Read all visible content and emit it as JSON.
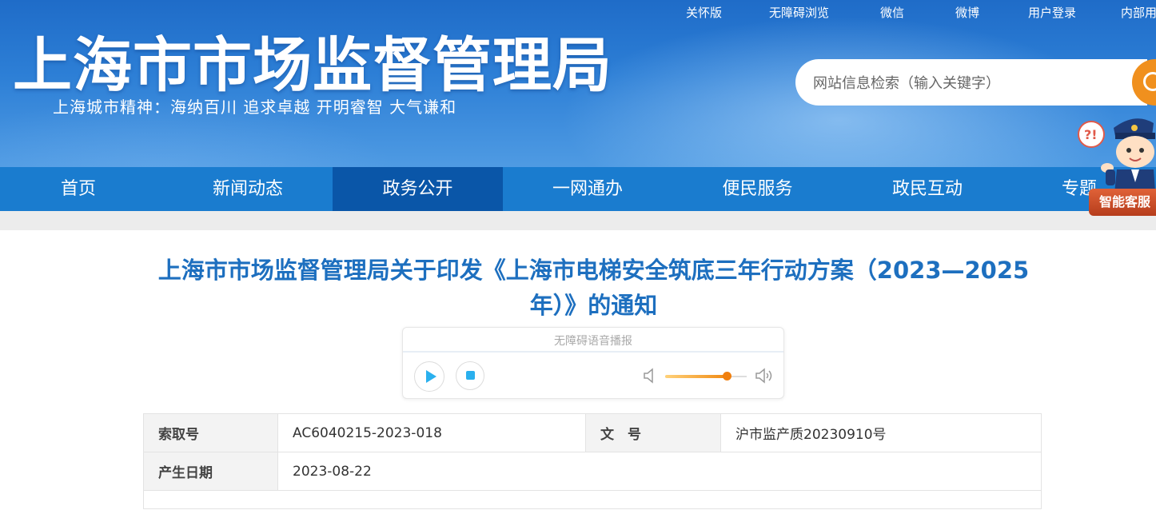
{
  "header": {
    "site_title": "上海市市场监督管理局",
    "slogan": "上海城市精神：海纳百川   追求卓越   开明睿智   大气谦和",
    "top_links": [
      "关怀版",
      "无障碍浏览",
      "微信",
      "微博",
      "用户登录",
      "内部用"
    ],
    "search_placeholder": "网站信息检索（输入关键字）",
    "service_badge": "智能客服"
  },
  "nav": {
    "items": [
      "首页",
      "新闻动态",
      "政务公开",
      "一网通办",
      "便民服务",
      "政民互动",
      "专题"
    ],
    "active_index": 2
  },
  "article": {
    "title": "上海市市场监督管理局关于印发《上海市电梯安全筑底三年行动方案（2023—2025年）》的通知"
  },
  "player": {
    "label": "无障碍语音播报",
    "volume": 0.75
  },
  "meta": {
    "index_label": "索取号",
    "index_value": "AC6040215-2023-018",
    "doc_no_label": "文　号",
    "doc_no_value": "沪市监产质20230910号",
    "date_label": "产生日期",
    "date_value": "2023-08-22"
  },
  "colors": {
    "header_blue": "#2d7fd6",
    "nav_blue": "#1a7ccf",
    "nav_active": "#0a56a8",
    "title_blue": "#1d6fbf",
    "accent_orange": "#f0901e"
  }
}
